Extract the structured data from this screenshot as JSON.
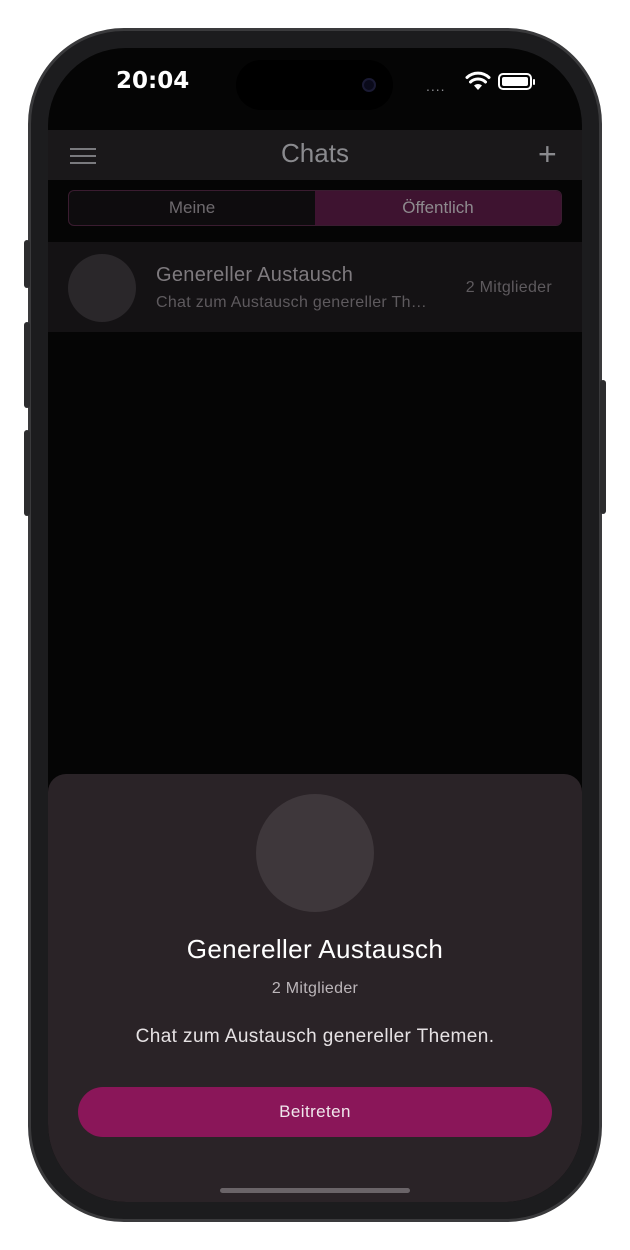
{
  "status_bar": {
    "time": "20:04",
    "signal": "....",
    "wifi_icon": "wifi-icon",
    "battery_icon": "battery-icon"
  },
  "header": {
    "title": "Chats",
    "menu_icon": "hamburger-menu-icon",
    "add_label": "+"
  },
  "tabs": [
    {
      "label": "Meine",
      "active": false
    },
    {
      "label": "Öffentlich",
      "active": true
    }
  ],
  "chats": [
    {
      "name": "Genereller Austausch",
      "preview": "Chat zum Austausch genereller Themen.",
      "members": "2 Mitglieder"
    }
  ],
  "sheet": {
    "title": "Genereller Austausch",
    "members": "2 Mitglieder",
    "description": "Chat zum Austausch genereller Themen.",
    "join_label": "Beitreten"
  },
  "colors": {
    "accent": "#8a1659",
    "sheet_background": "#2a2327",
    "screen_background": "#050505"
  }
}
